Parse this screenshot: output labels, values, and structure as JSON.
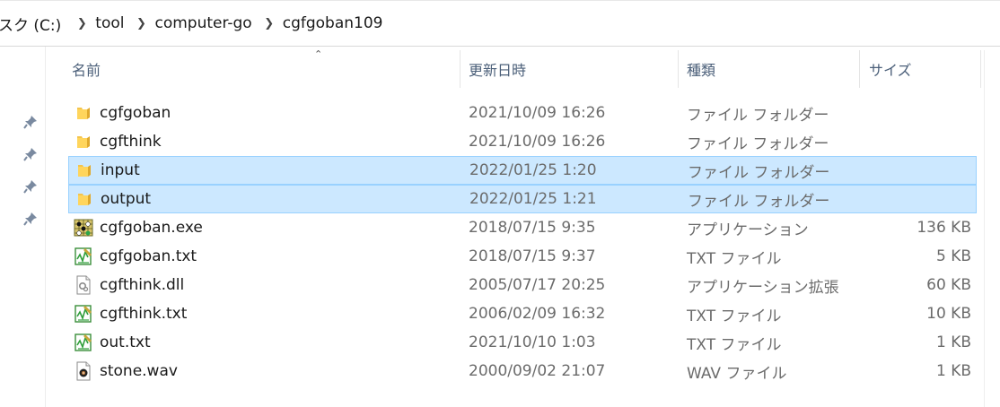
{
  "breadcrumb": {
    "items": [
      {
        "label": "スク (C:)"
      },
      {
        "label": "tool"
      },
      {
        "label": "computer-go"
      },
      {
        "label": "cgfgoban109"
      }
    ]
  },
  "columns": {
    "name": "名前",
    "date": "更新日時",
    "type": "種類",
    "size": "サイズ"
  },
  "sort": {
    "column": "name",
    "direction": "ascending"
  },
  "colors": {
    "selected_bg": "#cce8ff",
    "selected_border": "#99d1ff",
    "folder": "#f4c44c",
    "header_text": "#4c607a"
  },
  "files": [
    {
      "icon": "folder-icon",
      "name": "cgfgoban",
      "date": "2021/10/09 16:26",
      "type": "ファイル フォルダー",
      "size": "",
      "selected": false
    },
    {
      "icon": "folder-icon",
      "name": "cgfthink",
      "date": "2021/10/09 16:26",
      "type": "ファイル フォルダー",
      "size": "",
      "selected": false
    },
    {
      "icon": "folder-icon",
      "name": "input",
      "date": "2022/01/25 1:20",
      "type": "ファイル フォルダー",
      "size": "",
      "selected": true
    },
    {
      "icon": "folder-icon",
      "name": "output",
      "date": "2022/01/25 1:21",
      "type": "ファイル フォルダー",
      "size": "",
      "selected": true
    },
    {
      "icon": "goban-exe-icon",
      "name": "cgfgoban.exe",
      "date": "2018/07/15 9:35",
      "type": "アプリケーション",
      "size": "136 KB",
      "selected": false
    },
    {
      "icon": "notepad-txt-icon",
      "name": "cgfgoban.txt",
      "date": "2018/07/15 9:37",
      "type": "TXT ファイル",
      "size": "5 KB",
      "selected": false
    },
    {
      "icon": "dll-file-icon",
      "name": "cgfthink.dll",
      "date": "2005/07/17 20:25",
      "type": "アプリケーション拡張",
      "size": "60 KB",
      "selected": false
    },
    {
      "icon": "notepad-txt-icon",
      "name": "cgfthink.txt",
      "date": "2006/02/09 16:32",
      "type": "TXT ファイル",
      "size": "10 KB",
      "selected": false
    },
    {
      "icon": "notepad-txt-icon",
      "name": "out.txt",
      "date": "2021/10/10 1:03",
      "type": "TXT ファイル",
      "size": "1 KB",
      "selected": false
    },
    {
      "icon": "wav-audio-icon",
      "name": "stone.wav",
      "date": "2000/09/02 21:07",
      "type": "WAV ファイル",
      "size": "1 KB",
      "selected": false
    }
  ],
  "quick_access_pins": [
    "pin-icon",
    "pin-icon",
    "pin-icon",
    "pin-icon"
  ]
}
